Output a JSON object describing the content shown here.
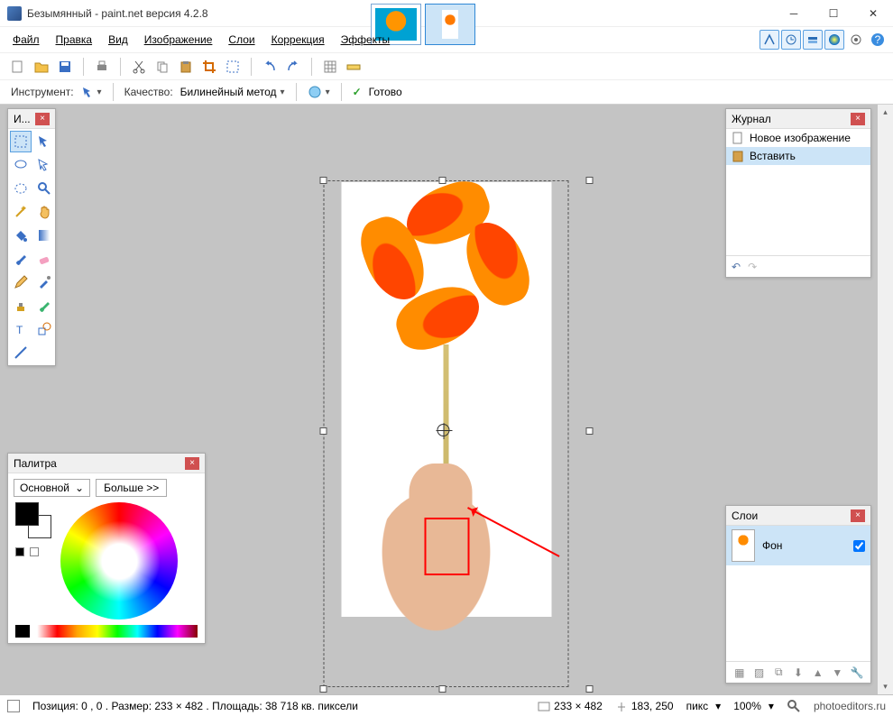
{
  "title": "Безымянный - paint.net версия 4.2.8",
  "menus": {
    "file": "Файл",
    "edit": "Правка",
    "view": "Вид",
    "image": "Изображение",
    "layers": "Слои",
    "correction": "Коррекция",
    "effects": "Эффекты"
  },
  "options": {
    "tool_label": "Инструмент:",
    "quality_label": "Качество:",
    "quality_value": "Билинейный метод",
    "ready": "Готово"
  },
  "tools_panel": {
    "title": "И..."
  },
  "history": {
    "title": "Журнал",
    "items": [
      "Новое изображение",
      "Вставить"
    ]
  },
  "layers": {
    "title": "Слои",
    "items": [
      {
        "name": "Фон",
        "visible": true
      }
    ]
  },
  "palette": {
    "title": "Палитра",
    "mode": "Основной",
    "more": "Больше >>"
  },
  "status": {
    "info": "Позиция: 0 , 0 . Размер: 233  × 482 . Площадь: 38 718 кв. пиксели",
    "canvas_size": "233 × 482",
    "cursor": "183, 250",
    "units": "пикс",
    "zoom": "100%",
    "credit": "photoeditors.ru"
  }
}
